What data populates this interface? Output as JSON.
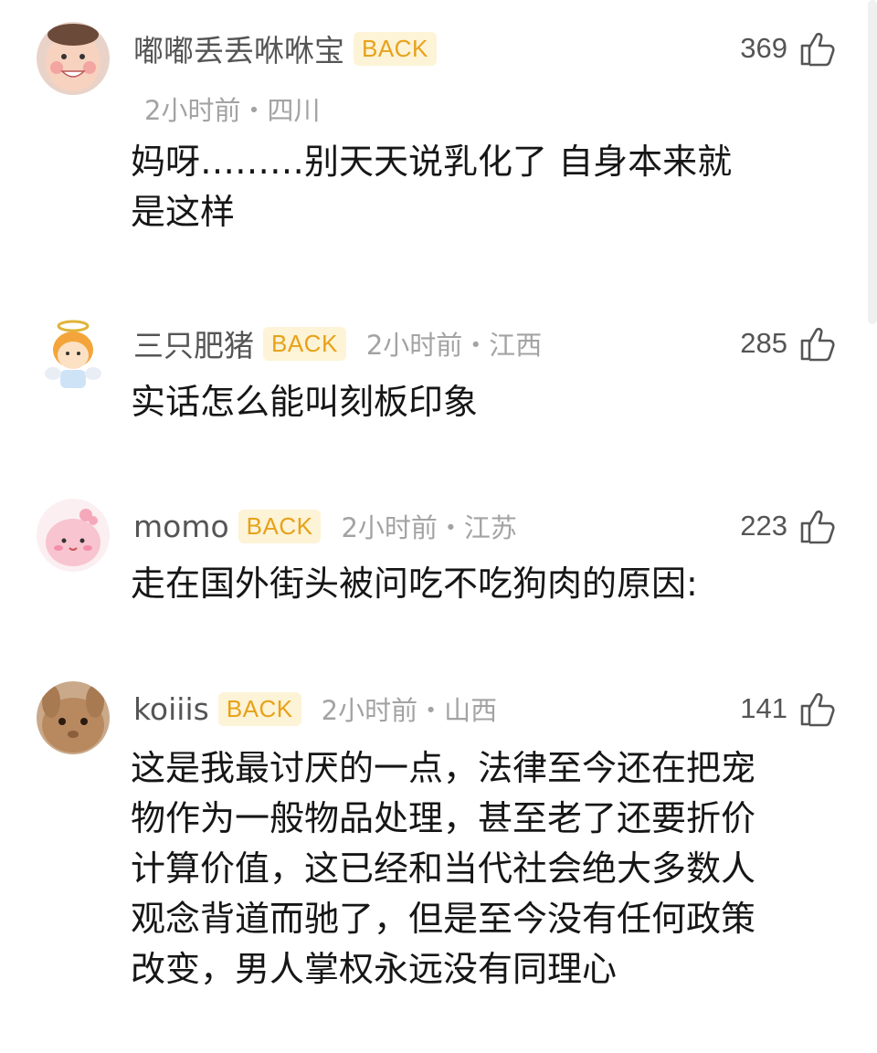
{
  "comments": [
    {
      "username": "嘟嘟丢丢咻咻宝",
      "badge": "BACK",
      "time_location": "2小时前・四川",
      "likes": "369",
      "text": "妈呀………别天天说乳化了 自身本来就\n是这样",
      "avatar_icon": "baby-face-avatar"
    },
    {
      "username": "三只肥猪",
      "badge": "BACK",
      "time_location": "2小时前・江西",
      "likes": "285",
      "text": "实话怎么能叫刻板印象",
      "avatar_icon": "angel-cartoon-avatar"
    },
    {
      "username": "momo",
      "badge": "BACK",
      "time_location": "2小时前・江苏",
      "likes": "223",
      "text": "走在国外街头被问吃不吃狗肉的原因:",
      "avatar_icon": "pink-cartoon-avatar"
    },
    {
      "username": "koiiis",
      "badge": "BACK",
      "time_location": "2小时前・山西",
      "likes": "141",
      "text": "这是我最讨厌的一点，法律至今还在把宠\n物作为一般物品处理，甚至老了还要折价\n计算价值，这已经和当代社会绝大多数人\n观念背道而驰了，但是至今没有任何政策\n改变，男人掌权永远没有同理心",
      "avatar_icon": "rabbit-photo-avatar"
    }
  ],
  "colors": {
    "badge_bg": "#fdf3d6",
    "badge_text": "#e7a21a",
    "meta": "#a3a3a3"
  }
}
